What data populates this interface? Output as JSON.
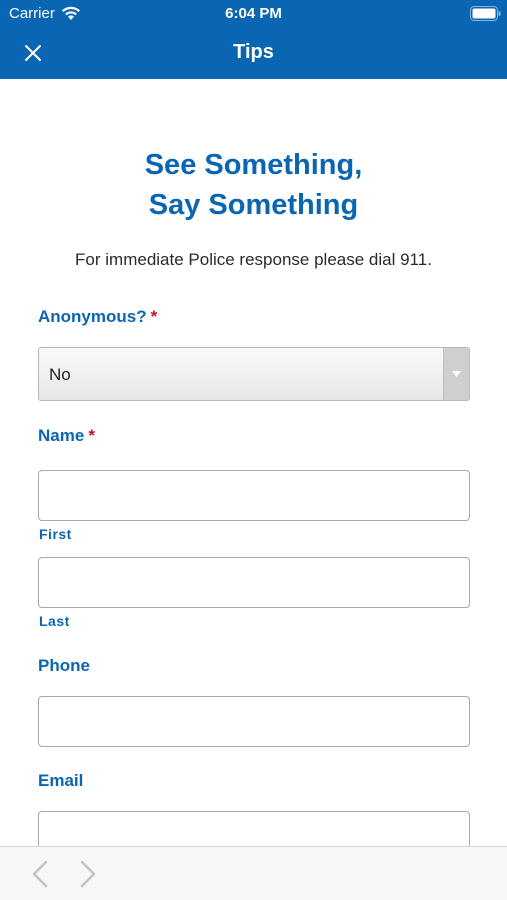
{
  "status_bar": {
    "carrier": "Carrier",
    "time": "6:04 PM"
  },
  "nav": {
    "title": "Tips"
  },
  "form": {
    "heading_line1": "See Something,",
    "heading_line2": "Say Something",
    "notice": "For immediate Police response please dial 911.",
    "anonymous": {
      "label": "Anonymous?",
      "required_mark": "*",
      "selected": "No"
    },
    "name": {
      "label": "Name",
      "required_mark": "*",
      "first_label": "First",
      "last_label": "Last",
      "first_value": "",
      "last_value": ""
    },
    "phone": {
      "label": "Phone",
      "value": ""
    },
    "email": {
      "label": "Email",
      "value": ""
    }
  },
  "colors": {
    "brand": "#0a66b2",
    "required": "#c8102e"
  },
  "icons": {
    "close": "close-icon",
    "back": "chevron-left-icon",
    "forward": "chevron-right-icon",
    "dropdown": "triangle-down-icon"
  }
}
